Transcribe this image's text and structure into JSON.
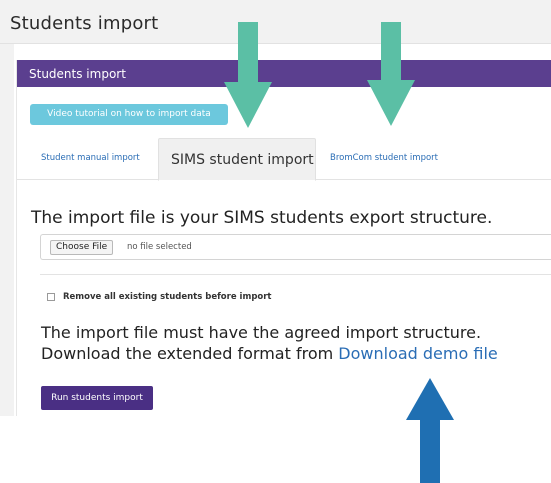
{
  "page": {
    "title": "Students import"
  },
  "panel": {
    "title": "Students import",
    "video_button": "Video tutorial on how to import data",
    "tabs": [
      {
        "label": "Student manual import"
      },
      {
        "label": "SIMS student import",
        "active": true
      },
      {
        "label": "BromCom student import"
      }
    ],
    "heading": "The import file is your SIMS students export structure.",
    "file_input": {
      "button_label": "Choose File",
      "status": "no file selected"
    },
    "remove_existing": {
      "label": "Remove all existing students before import",
      "checked": false
    },
    "info_line1": "The import file must have the agreed import structure.",
    "info_line2_prefix": "Download the extended format from ",
    "demo_link": "Download demo file",
    "run_button": "Run students import"
  },
  "annotations": {
    "arrow_color_green": "#5bbfa5",
    "arrow_color_blue": "#1f6fb2",
    "arrows": [
      {
        "name": "arrow-to-sims-tab",
        "direction": "down",
        "color": "green"
      },
      {
        "name": "arrow-to-bromcom-tab",
        "direction": "down",
        "color": "green"
      },
      {
        "name": "arrow-to-demo-link",
        "direction": "up",
        "color": "blue"
      }
    ]
  },
  "colors": {
    "header_bar": "#5b3f8f",
    "video_button": "#6cc8dd",
    "run_button": "#4a2f84",
    "link": "#2a6db5"
  }
}
